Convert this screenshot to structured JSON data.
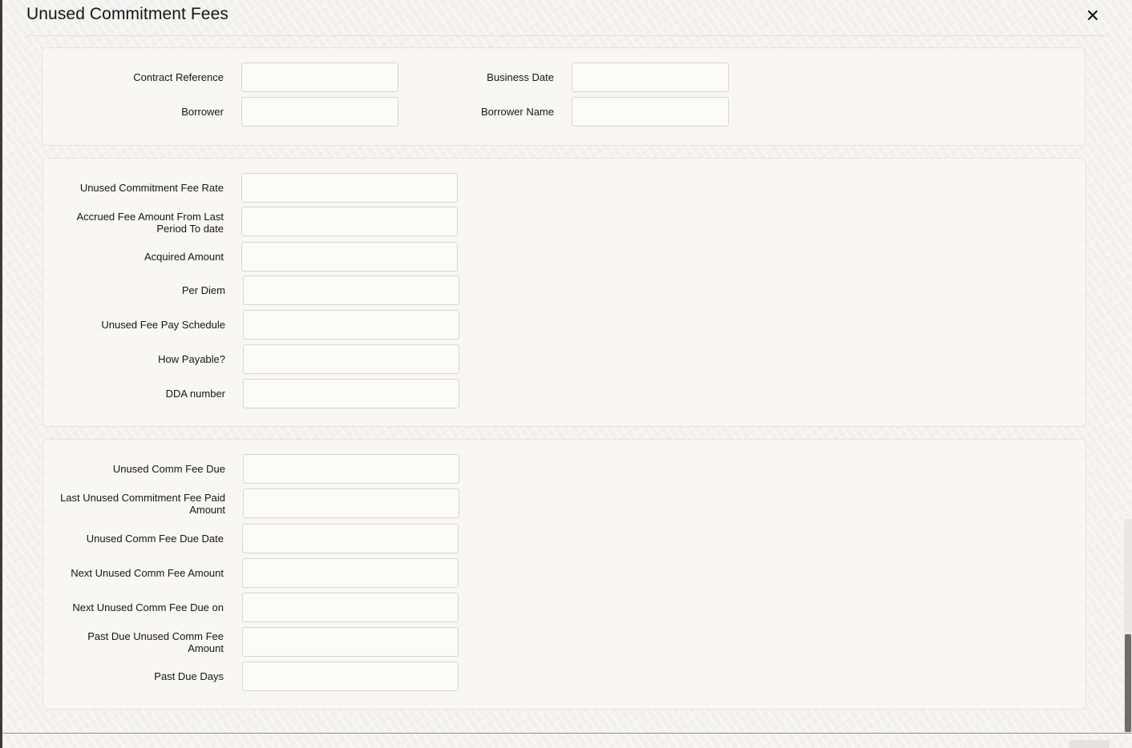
{
  "dialog": {
    "title": "Unused Commitment Fees",
    "close_icon": "close-icon"
  },
  "header_section": {
    "contract_reference": {
      "label": "Contract Reference",
      "value": ""
    },
    "business_date": {
      "label": "Business Date",
      "value": ""
    },
    "borrower": {
      "label": "Borrower",
      "value": ""
    },
    "borrower_name": {
      "label": "Borrower Name",
      "value": ""
    }
  },
  "fee_section": {
    "unused_commitment_fee_rate": {
      "label": "Unused Commitment Fee Rate",
      "value": ""
    },
    "accrued_fee_amount": {
      "label": "Accrued Fee Amount From Last Period To date",
      "value": ""
    },
    "acquired_amount": {
      "label": "Acquired Amount",
      "value": ""
    },
    "per_diem": {
      "label": "Per Diem",
      "value": ""
    },
    "unused_fee_pay_schedule": {
      "label": "Unused Fee Pay Schedule",
      "value": ""
    },
    "how_payable": {
      "label": "How Payable?",
      "value": ""
    },
    "dda_number": {
      "label": "DDA number",
      "value": ""
    }
  },
  "due_section": {
    "unused_comm_fee_due": {
      "label": "Unused Comm Fee Due",
      "value": ""
    },
    "last_unused_commitment_fee_paid_amount": {
      "label": "Last Unused Commitment Fee Paid Amount",
      "value": ""
    },
    "unused_comm_fee_due_date": {
      "label": "Unused Comm Fee Due Date",
      "value": ""
    },
    "next_unused_comm_fee_amount": {
      "label": "Next Unused Comm Fee Amount",
      "value": ""
    },
    "next_unused_comm_fee_due_on": {
      "label": "Next Unused Comm Fee Due on",
      "value": ""
    },
    "past_due_unused_comm_fee_amount": {
      "label": "Past Due Unused Comm Fee Amount",
      "value": ""
    },
    "past_due_days": {
      "label": "Past Due Days",
      "value": ""
    }
  }
}
